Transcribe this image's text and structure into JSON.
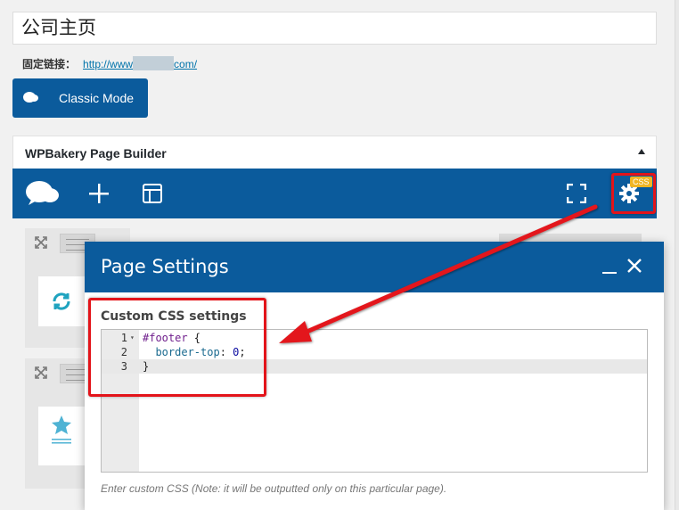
{
  "post": {
    "title": "公司主页",
    "permalink_label": "固定链接：",
    "permalink_start": "http://www",
    "permalink_end": "com/"
  },
  "classic_mode_label": "Classic Mode",
  "builder": {
    "title": "WPBakery Page Builder",
    "css_badge": "CSS"
  },
  "modal": {
    "title": "Page Settings",
    "section_label": "Custom CSS settings",
    "editor_lines": [
      {
        "num": "1",
        "selector": "#footer",
        "rest": " {"
      },
      {
        "num": "2",
        "prop": "  border-top",
        "colon": ": ",
        "value": "0",
        "end": ";"
      },
      {
        "num": "3",
        "code": "}"
      }
    ],
    "hint": "Enter custom CSS (Note: it will be outputted only on this particular page)."
  },
  "colors": {
    "brand_blue": "#0b5b9c",
    "highlight_red": "#e3141a",
    "badge_yellow": "#f1b522"
  },
  "icons": [
    "logo-cloud-icon",
    "plus-icon",
    "layout-icon",
    "fullscreen-icon",
    "gear-icon",
    "close-icon",
    "minimize-icon",
    "refresh-icon",
    "star-icon"
  ]
}
